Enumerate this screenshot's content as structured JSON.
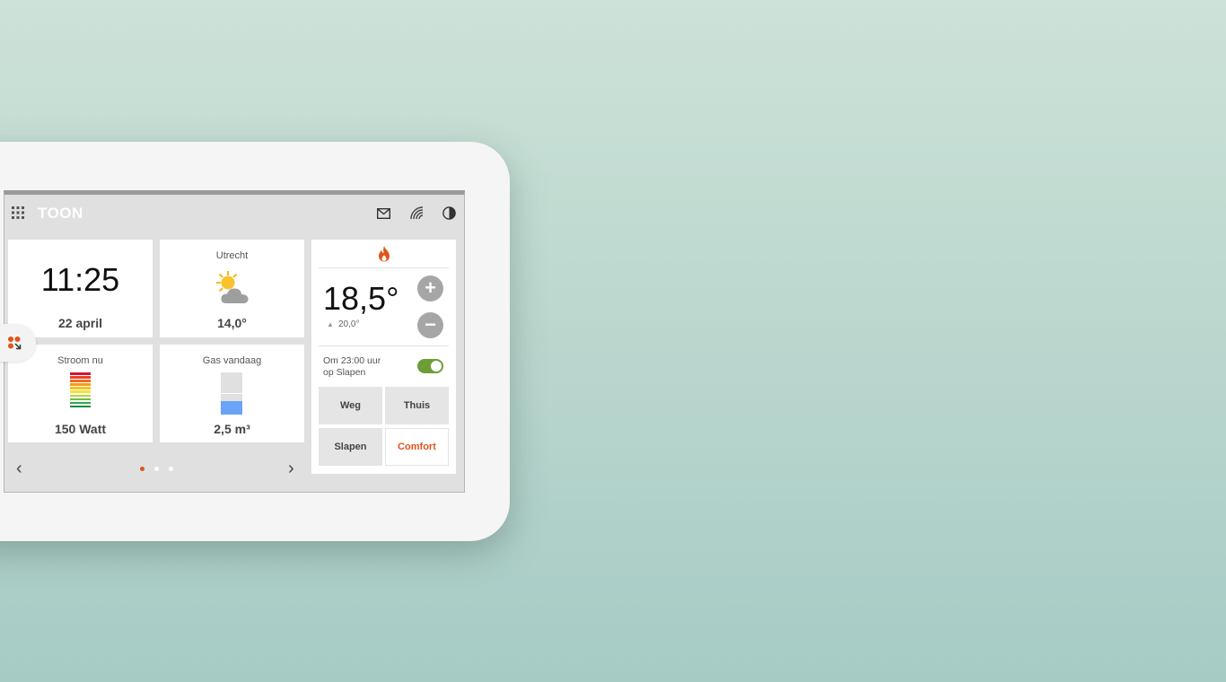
{
  "header": {
    "logo": "TOON",
    "icons": [
      "apps-grid-icon",
      "mail-icon",
      "wifi-signal-icon",
      "contrast-icon"
    ]
  },
  "clock_tile": {
    "time": "11:25",
    "date": "22 april"
  },
  "weather_tile": {
    "city": "Utrecht",
    "temperature": "14,0°",
    "icon": "partly-cloudy-icon"
  },
  "power_tile": {
    "label": "Stroom nu",
    "value": "150 Watt",
    "bar_colors": [
      "#d6142d",
      "#e9412c",
      "#ef6b22",
      "#f39b1e",
      "#f7c419",
      "#f2e23a",
      "#b9d63a",
      "#6fbe44",
      "#2ea84f",
      "#178a3e"
    ]
  },
  "gas_tile": {
    "label": "Gas vandaag",
    "value": "2,5 m³",
    "fill_fraction": 0.31
  },
  "pager": {
    "pages": 3,
    "active_index": 0
  },
  "thermostat": {
    "temperature": "18,5°",
    "setpoint": "20,0°",
    "schedule_line1": "Om 23:00 uur",
    "schedule_line2": "op Slapen",
    "schedule_enabled": true,
    "plus": "+",
    "minus": "−",
    "modes": [
      {
        "label": "Weg",
        "active": false
      },
      {
        "label": "Thuis",
        "active": false
      },
      {
        "label": "Slapen",
        "active": false
      },
      {
        "label": "Comfort",
        "active": true
      }
    ]
  },
  "colors": {
    "accent": "#e0541a",
    "toggle_on": "#6c9e35",
    "gas_fill": "#6aa3f8"
  }
}
